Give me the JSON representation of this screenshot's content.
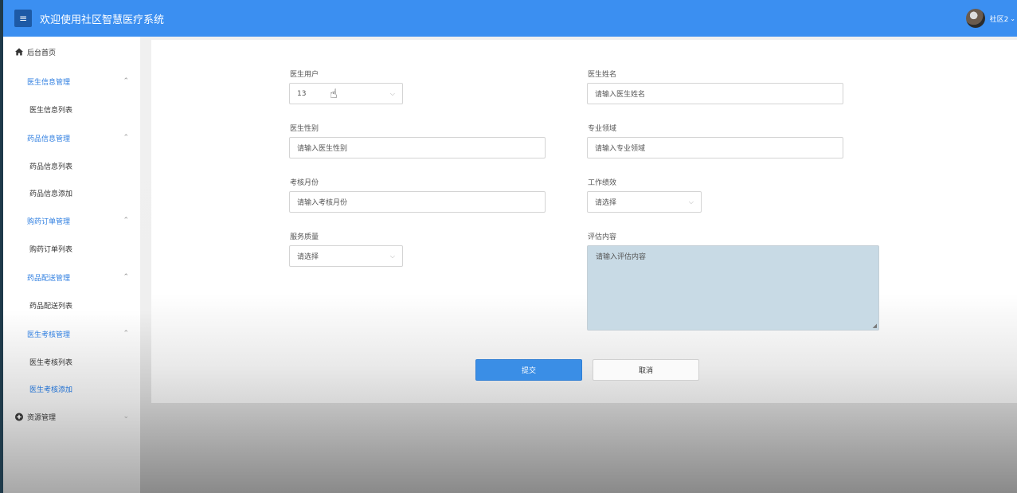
{
  "header": {
    "menu_icon": "hamburger-icon",
    "title": "欢迎使用社区智慧医疗系统",
    "user_name": "社区2",
    "caret": "⌄"
  },
  "sidebar": {
    "home": "后台首页",
    "groups": [
      {
        "label": "医生信息管理",
        "items": [
          "医生信息列表"
        ]
      },
      {
        "label": "药品信息管理",
        "items": [
          "药品信息列表",
          "药品信息添加"
        ]
      },
      {
        "label": "购药订单管理",
        "items": [
          "购药订单列表"
        ]
      },
      {
        "label": "药品配送管理",
        "items": [
          "药品配送列表"
        ]
      },
      {
        "label": "医生考核管理",
        "items": [
          "医生考核列表",
          "医生考核添加"
        ]
      }
    ],
    "resource": "资源管理",
    "active_item": "医生考核添加"
  },
  "form": {
    "doctor_user": {
      "label": "医生用户",
      "value": "13"
    },
    "doctor_name": {
      "label": "医生姓名",
      "placeholder": "请输入医生姓名"
    },
    "doctor_gender": {
      "label": "医生性别",
      "placeholder": "请输入医生性别"
    },
    "specialty": {
      "label": "专业领域",
      "placeholder": "请输入专业领域"
    },
    "review_month": {
      "label": "考核月份",
      "placeholder": "请输入考核月份"
    },
    "performance": {
      "label": "工作绩效",
      "value": "请选择"
    },
    "service_quality": {
      "label": "服务质量",
      "value": "请选择"
    },
    "evaluation": {
      "label": "评估内容",
      "placeholder": "请输入评估内容"
    },
    "submit": "提交",
    "cancel": "取消"
  },
  "colors": {
    "header": "#3b8ff1",
    "accent": "#2e7ee0",
    "primary_button": "#3a8ee6"
  }
}
